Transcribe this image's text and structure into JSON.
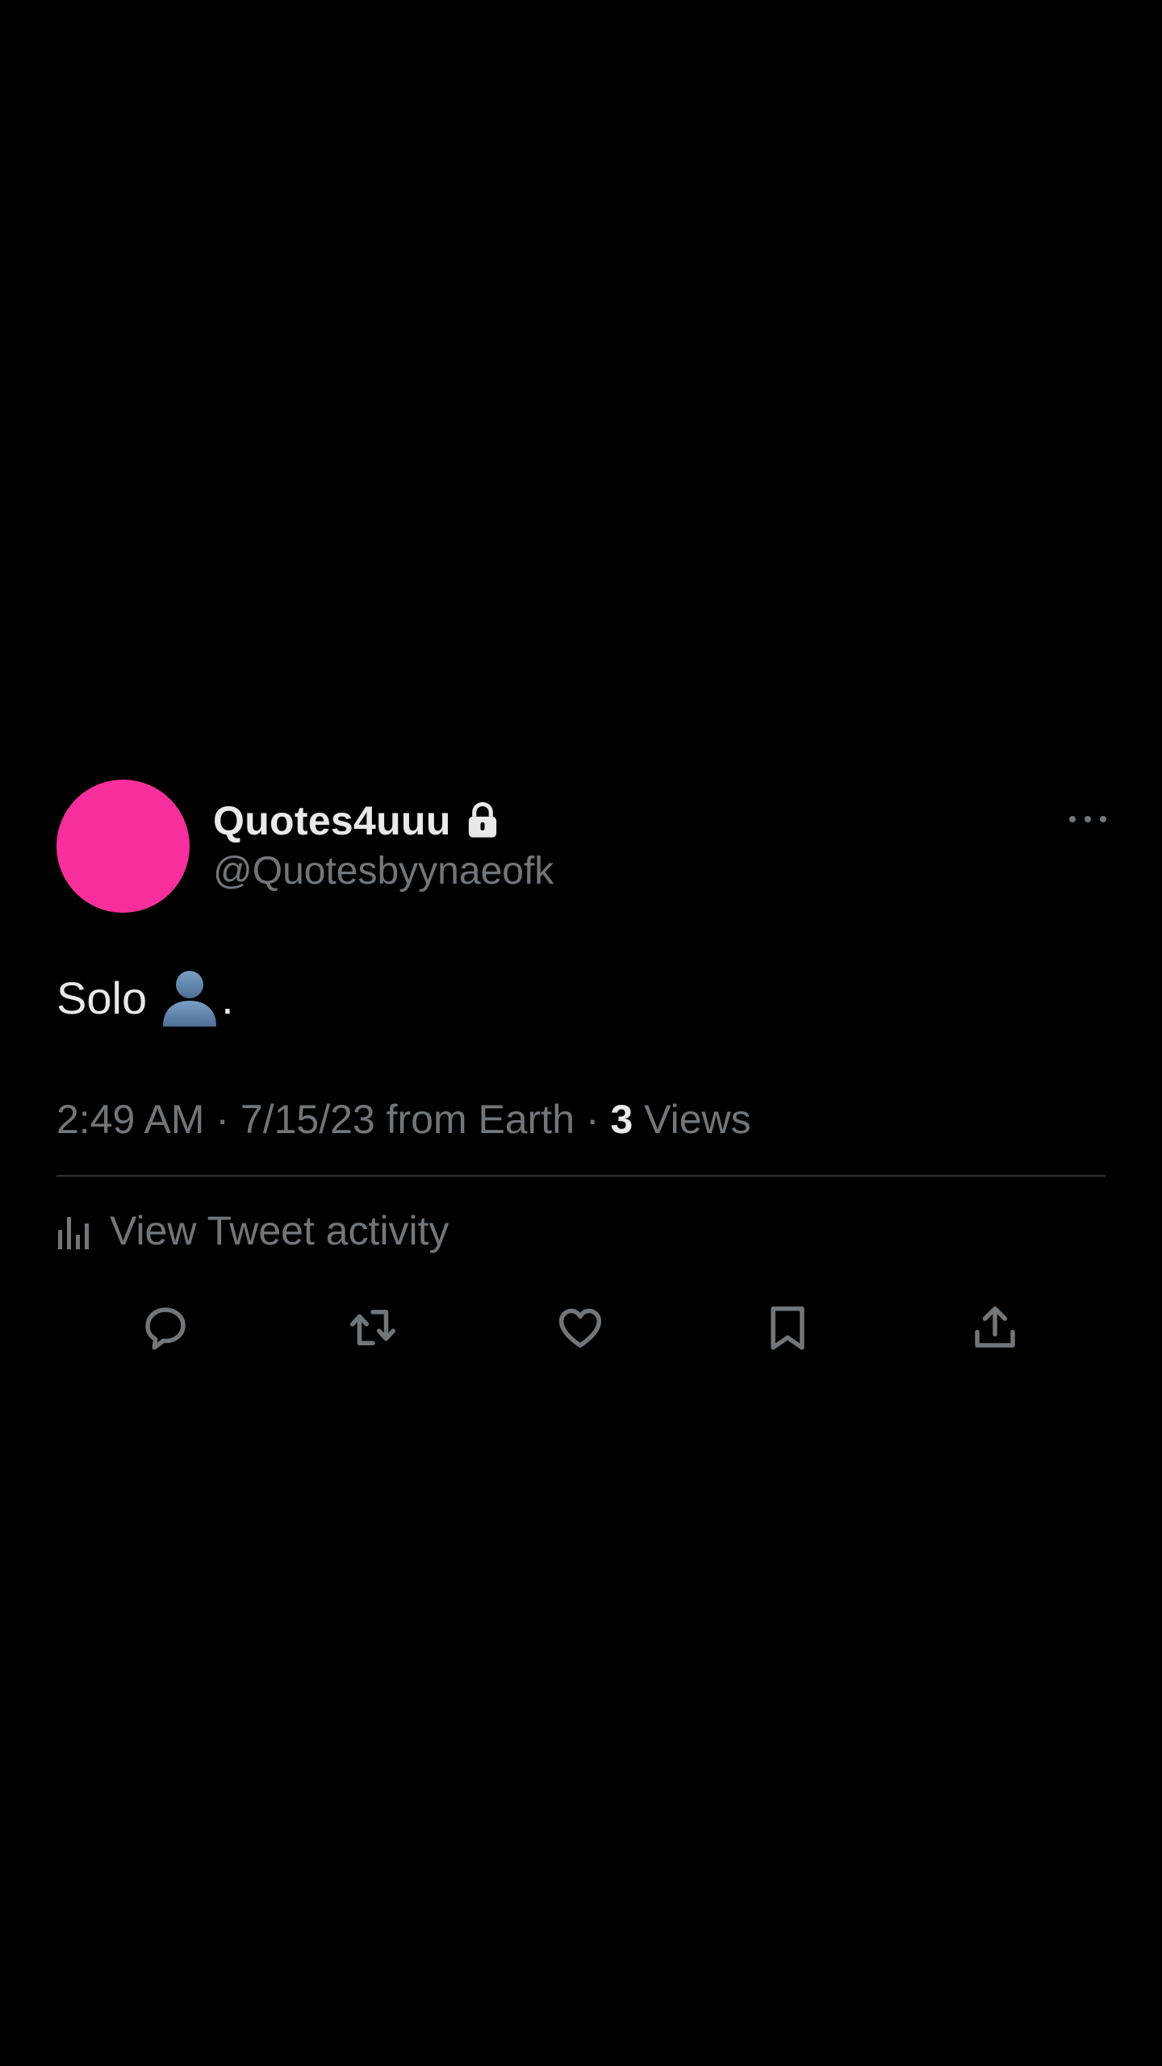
{
  "tweet": {
    "display_name": "Quotes4uuu",
    "handle": "@Quotesbyynaeofk",
    "avatar_color": "#f72f9c",
    "text_before": "Solo",
    "text_after": ".",
    "emoji_icon": "bust-in-silhouette-icon",
    "time": "2:49 AM",
    "sep1": " · ",
    "date": "7/15/23",
    "source": " from Earth",
    "sep2": " · ",
    "views_count": "3",
    "views_label": " Views",
    "activity_label": "View Tweet activity"
  },
  "icons": {
    "lock": "lock-icon",
    "more": "more-options-icon",
    "activity": "bar-chart-icon",
    "reply": "reply-icon",
    "retweet": "retweet-icon",
    "like": "heart-icon",
    "bookmark": "bookmark-icon",
    "share": "share-icon"
  },
  "colors": {
    "background": "#000000",
    "primary_text": "#e7e9ea",
    "secondary_text": "#71767b",
    "divider": "#2f3336"
  }
}
